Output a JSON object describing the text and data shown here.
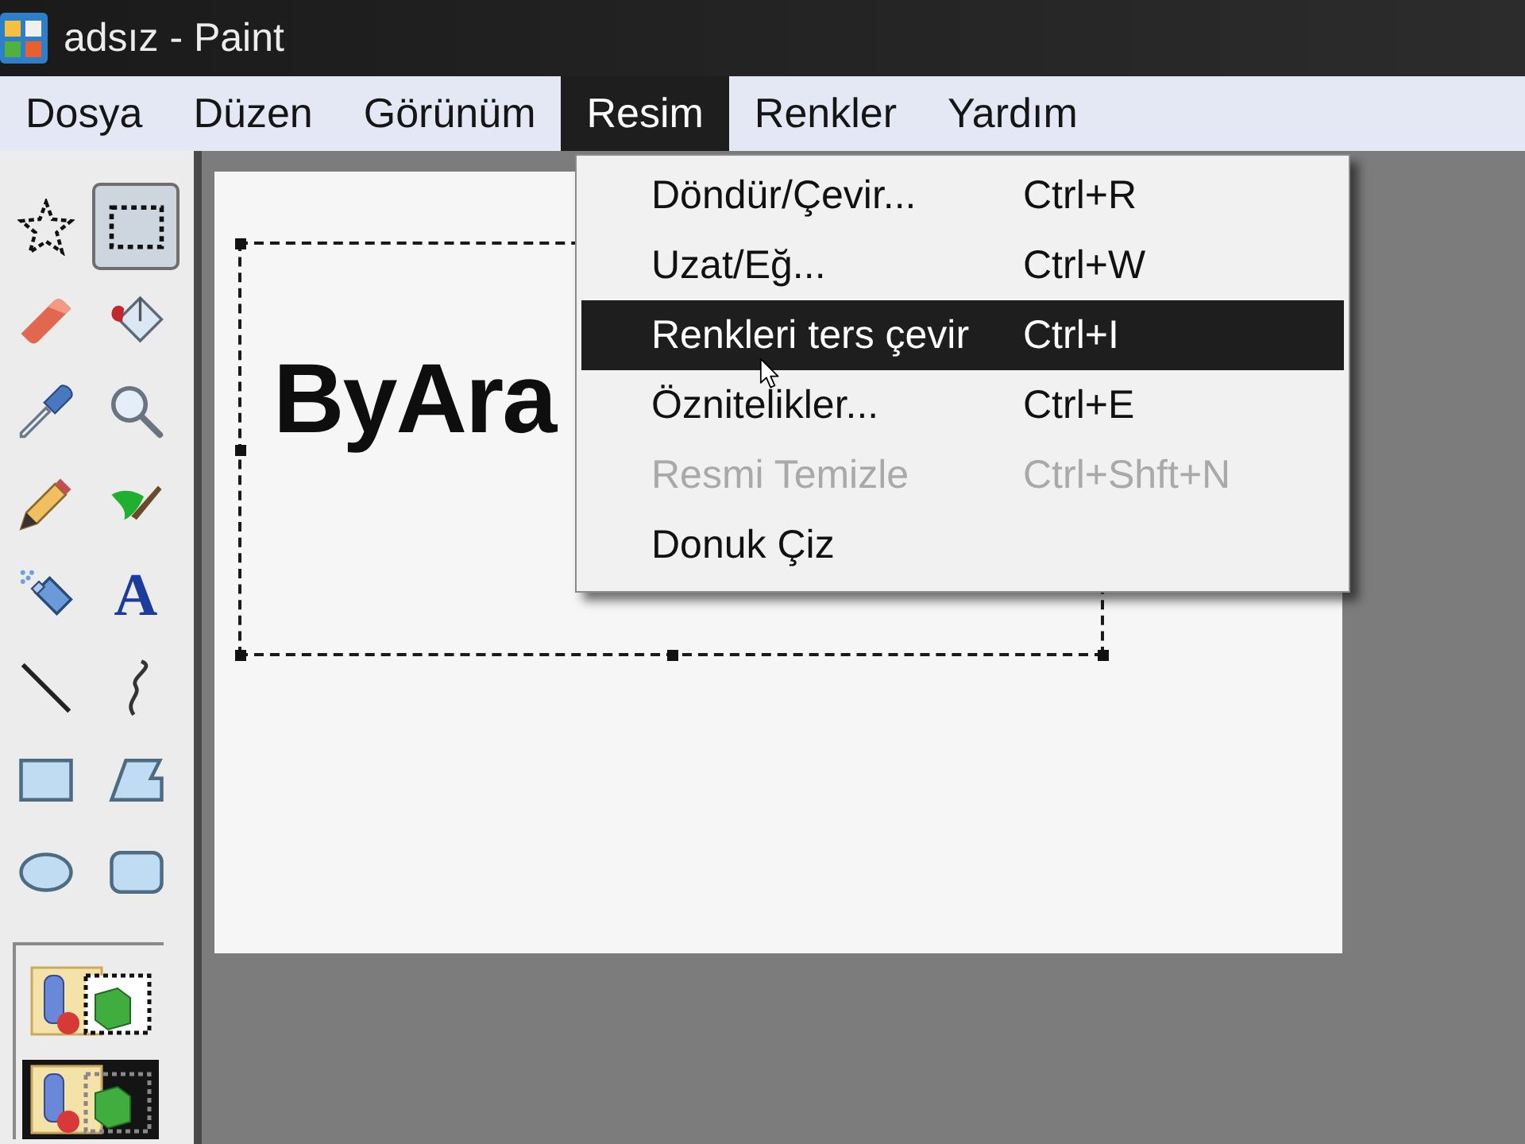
{
  "window": {
    "title": "adsız - Paint"
  },
  "menu_bar": [
    {
      "label": "Dosya",
      "selected": false
    },
    {
      "label": "Düzen",
      "selected": false
    },
    {
      "label": "Görünüm",
      "selected": false
    },
    {
      "label": "Resim",
      "selected": true
    },
    {
      "label": "Renkler",
      "selected": false
    },
    {
      "label": "Yardım",
      "selected": false
    }
  ],
  "tools": [
    {
      "kind": "lasso",
      "selected": false
    },
    {
      "kind": "marquee",
      "selected": true
    },
    {
      "kind": "eraser",
      "selected": false
    },
    {
      "kind": "bucket",
      "selected": false
    },
    {
      "kind": "dropper",
      "selected": false
    },
    {
      "kind": "magnifier",
      "selected": false
    },
    {
      "kind": "pencil",
      "selected": false
    },
    {
      "kind": "brush",
      "selected": false
    },
    {
      "kind": "airbrush",
      "selected": false
    },
    {
      "kind": "text",
      "glyph": "A",
      "selected": false
    },
    {
      "kind": "line",
      "selected": false
    },
    {
      "kind": "curve",
      "selected": false
    },
    {
      "kind": "rectangle",
      "selected": false
    },
    {
      "kind": "polygon",
      "selected": false
    },
    {
      "kind": "ellipse",
      "selected": false
    },
    {
      "kind": "roundrect",
      "selected": false
    }
  ],
  "tool_options": [
    {
      "kind": "opaque",
      "selected": false
    },
    {
      "kind": "transparent",
      "selected": true
    }
  ],
  "canvas": {
    "text": "ByAra",
    "selection": true
  },
  "dropdown_menu": {
    "items": [
      {
        "label": "Döndür/Çevir...",
        "shortcut": "Ctrl+R",
        "selected": false,
        "disabled": false
      },
      {
        "label": "Uzat/Eğ...",
        "shortcut": "Ctrl+W",
        "selected": false,
        "disabled": false
      },
      {
        "label": "Renkleri ters çevir",
        "shortcut": "Ctrl+I",
        "selected": true,
        "disabled": false
      },
      {
        "label": "Öznitelikler...",
        "shortcut": "Ctrl+E",
        "selected": false,
        "disabled": false
      },
      {
        "label": "Resmi Temizle",
        "shortcut": "Ctrl+Shft+N",
        "selected": false,
        "disabled": true
      },
      {
        "label": "Donuk Çiz",
        "selected": false,
        "disabled": false
      }
    ]
  }
}
